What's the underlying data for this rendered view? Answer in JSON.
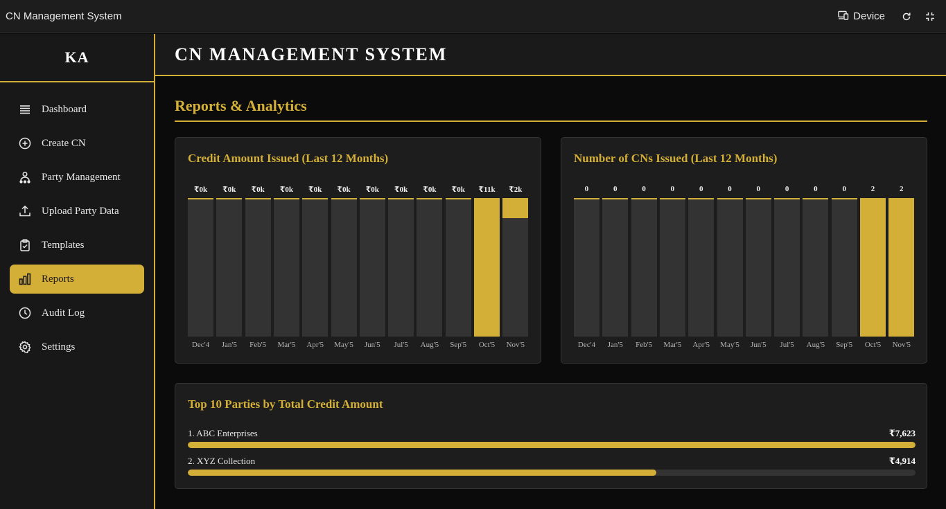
{
  "app": {
    "title": "CN Management System",
    "device_label": "Device"
  },
  "sidebar": {
    "brand": "KA",
    "items": [
      {
        "label": "Dashboard",
        "icon": "menu-icon"
      },
      {
        "label": "Create CN",
        "icon": "plus-circle-icon"
      },
      {
        "label": "Party Management",
        "icon": "users-icon"
      },
      {
        "label": "Upload Party Data",
        "icon": "upload-icon"
      },
      {
        "label": "Templates",
        "icon": "clipboard-icon"
      },
      {
        "label": "Reports",
        "icon": "bar-chart-icon",
        "active": true
      },
      {
        "label": "Audit Log",
        "icon": "clock-icon"
      },
      {
        "label": "Settings",
        "icon": "gear-icon"
      }
    ]
  },
  "header": {
    "title": "CN MANAGEMENT SYSTEM"
  },
  "section": {
    "title": "Reports & Analytics"
  },
  "credit_chart": {
    "title": "Credit Amount Issued (Last 12 Months)"
  },
  "count_chart": {
    "title": "Number of CNs Issued (Last 12 Months)"
  },
  "parties": {
    "title": "Top 10 Parties by Total Credit Amount",
    "items": [
      {
        "name": "1. ABC Enterprises",
        "amount": "₹7,623",
        "fraction": 1.0
      },
      {
        "name": "2. XYZ Collection",
        "amount": "₹4,914",
        "fraction": 0.644
      }
    ]
  },
  "colors": {
    "accent": "#d4af37",
    "track": "#333333",
    "card": "#1d1d1d",
    "bg": "#0b0b0b"
  },
  "chart_data": [
    {
      "type": "bar",
      "title": "Credit Amount Issued (Last 12 Months)",
      "categories": [
        "Dec'4",
        "Jan'5",
        "Feb'5",
        "Mar'5",
        "Apr'5",
        "May'5",
        "Jun'5",
        "Jul'5",
        "Aug'5",
        "Sep'5",
        "Oct'5",
        "Nov'5"
      ],
      "value_labels": [
        "₹0k",
        "₹0k",
        "₹0k",
        "₹0k",
        "₹0k",
        "₹0k",
        "₹0k",
        "₹0k",
        "₹0k",
        "₹0k",
        "₹11k",
        "₹2k"
      ],
      "values": [
        0,
        0,
        0,
        0,
        0,
        0,
        0,
        0,
        0,
        0,
        11,
        1.5
      ]
    },
    {
      "type": "bar",
      "title": "Number of CNs Issued (Last 12 Months)",
      "categories": [
        "Dec'4",
        "Jan'5",
        "Feb'5",
        "Mar'5",
        "Apr'5",
        "May'5",
        "Jun'5",
        "Jul'5",
        "Aug'5",
        "Sep'5",
        "Oct'5",
        "Nov'5"
      ],
      "value_labels": [
        "0",
        "0",
        "0",
        "0",
        "0",
        "0",
        "0",
        "0",
        "0",
        "0",
        "2",
        "2"
      ],
      "values": [
        0,
        0,
        0,
        0,
        0,
        0,
        0,
        0,
        0,
        0,
        2,
        2
      ]
    }
  ]
}
